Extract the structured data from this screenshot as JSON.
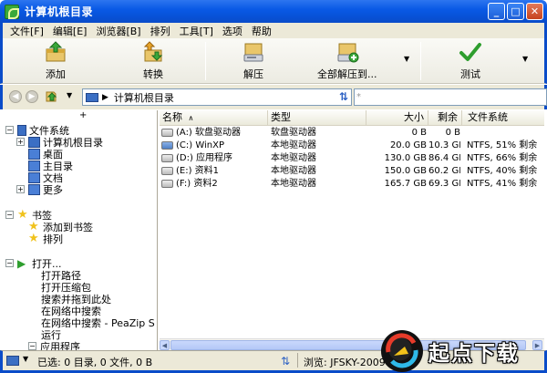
{
  "window": {
    "title": "计算机根目录"
  },
  "menu": [
    "文件[F]",
    "编辑[E]",
    "浏览器[B]",
    "排列",
    "工具[T]",
    "选项",
    "帮助"
  ],
  "toolbar": {
    "add": "添加",
    "convert": "转换",
    "extract": "解压",
    "extract_all": "全部解压到...",
    "test": "测试"
  },
  "address": {
    "path": "计算机根目录",
    "search_placeholder": "*"
  },
  "tree": {
    "filesystem": "文件系统",
    "computer_root": "计算机根目录",
    "desktop": "桌面",
    "home": "主目录",
    "documents": "文档",
    "more": "更多",
    "bookmarks": "书签",
    "add_bookmark": "添加到书签",
    "arrange": "排列",
    "open": "打开...",
    "open_path": "打开路径",
    "open_archive": "打开压缩包",
    "search_drag": "搜索并拖到此处",
    "web_search": "在网络中搜索",
    "web_search_peazip": "在网络中搜索 - PeaZip S",
    "run": "运行",
    "apps": "应用程序",
    "top_plus": "+"
  },
  "columns": {
    "name": "名称",
    "type": "类型",
    "size": "大小",
    "free": "剩余",
    "fs": "文件系统"
  },
  "drives": [
    {
      "name": "(A:) 软盘驱动器",
      "type": "软盘驱动器",
      "size": "0 B",
      "free": "0 B",
      "fs": ""
    },
    {
      "name": "(C:) WinXP",
      "type": "本地驱动器",
      "size": "20.0 GB",
      "free": "10.3 GB",
      "fs": "NTFS, 51% 剩余"
    },
    {
      "name": "(D:) 应用程序",
      "type": "本地驱动器",
      "size": "130.0 GB",
      "free": "86.4 GB",
      "fs": "NTFS, 66% 剩余"
    },
    {
      "name": "(E:) 资料1",
      "type": "本地驱动器",
      "size": "150.0 GB",
      "free": "60.2 GB",
      "fs": "NTFS, 40% 剩余"
    },
    {
      "name": "(F:) 资料2",
      "type": "本地驱动器",
      "size": "165.7 GB",
      "free": "69.3 GB",
      "fs": "NTFS, 41% 剩余"
    }
  ],
  "status": {
    "selection": "已选: 0 目录, 0 文件, 0 B",
    "browse": "浏览: JFSKY-200905C"
  },
  "watermark": {
    "text": "起点下载"
  },
  "colors": {
    "title_blue": "#0a5ae6",
    "menu_bg": "#ece9d8",
    "tree_icon_blue": "#3b6fc4",
    "bookmark_star": "#f0c21c",
    "open_green": "#2e9e2e"
  }
}
